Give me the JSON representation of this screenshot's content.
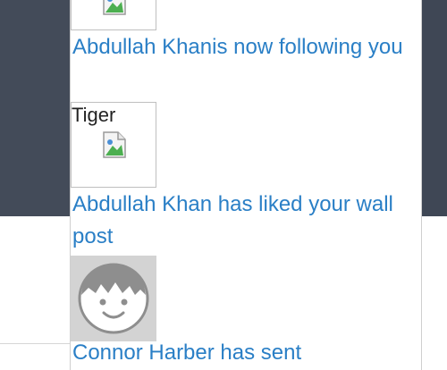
{
  "notifications": [
    {
      "text": "Abdullah Khanis now following you",
      "thumbnail_caption": ""
    },
    {
      "text": "Abdullah Khan has liked your wall post",
      "thumbnail_caption": "Tiger"
    },
    {
      "text": "Connor Harber has sent"
    }
  ],
  "colors": {
    "link": "#2a7fc6",
    "background_dark": "#434b59",
    "panel": "#ffffff"
  },
  "icons": {
    "broken_image": "broken-image-icon",
    "avatar": "default-avatar-icon"
  }
}
